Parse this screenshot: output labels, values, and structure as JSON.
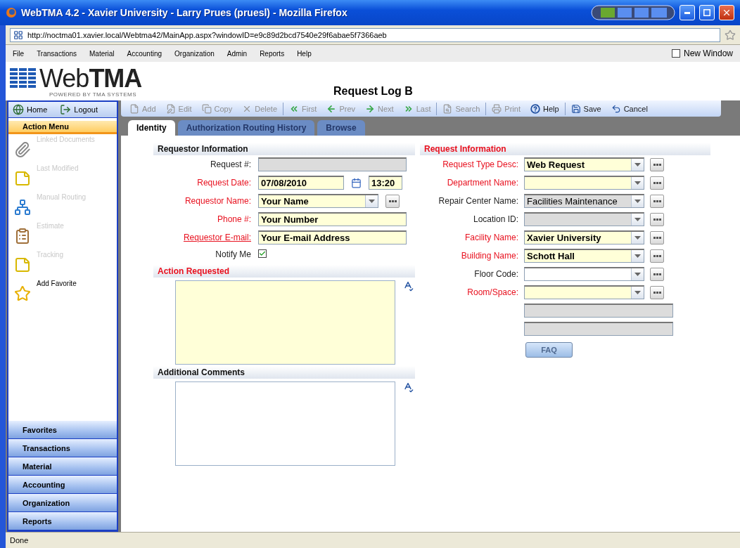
{
  "window": {
    "title": "WebTMA 4.2 - Xavier University - Larry Prues (pruesl) - Mozilla Firefox"
  },
  "address_bar": {
    "url": "http://noctma01.xavier.local/Webtma42/MainApp.aspx?windowID=e9c89d2bcd7540e29f6abae5f7366aeb"
  },
  "menu": [
    "File",
    "Transactions",
    "Material",
    "Accounting",
    "Organization",
    "Admin",
    "Reports",
    "Help"
  ],
  "new_window": {
    "label": "New Window",
    "checked": false
  },
  "logo": {
    "text": "Web**TMA**",
    "tagline": "POWERED BY TMA SYSTEMS"
  },
  "page_title": "Request Log B",
  "nav": [
    {
      "label": "Home",
      "kind": "home"
    },
    {
      "label": "Logout",
      "kind": "logout"
    }
  ],
  "action_menu": {
    "title": "Action Menu",
    "items": [
      {
        "label": "Linked Documents",
        "kind": "clip",
        "disabled": true
      },
      {
        "label": "Last Modified",
        "kind": "clock",
        "disabled": true
      },
      {
        "label": "Manual Routing",
        "kind": "routing",
        "disabled": true
      },
      {
        "label": "Estimate",
        "kind": "clipboard",
        "disabled": true
      },
      {
        "label": "Tracking",
        "kind": "track",
        "disabled": true
      },
      {
        "label": "Add Favorite",
        "kind": "star",
        "disabled": false
      }
    ]
  },
  "sections": [
    "Favorites",
    "Transactions",
    "Material",
    "Accounting",
    "Organization",
    "Reports"
  ],
  "toolbar": [
    [
      {
        "label": "Add",
        "kind": "add",
        "disabled": true
      },
      {
        "label": "Edit",
        "kind": "edit",
        "disabled": true
      },
      {
        "label": "Copy",
        "kind": "copy",
        "disabled": true
      },
      {
        "label": "Delete",
        "kind": "delete",
        "disabled": true
      }
    ],
    [
      {
        "label": "First",
        "kind": "first",
        "disabled": true
      },
      {
        "label": "Prev",
        "kind": "prev",
        "disabled": true
      },
      {
        "label": "Next",
        "kind": "next",
        "disabled": true
      },
      {
        "label": "Last",
        "kind": "last",
        "disabled": true
      }
    ],
    [
      {
        "label": "Search",
        "kind": "search",
        "disabled": true
      }
    ],
    [
      {
        "label": "Print",
        "kind": "print",
        "disabled": true
      },
      {
        "label": "Help",
        "kind": "help",
        "disabled": false
      }
    ],
    [
      {
        "label": "Save",
        "kind": "save",
        "disabled": false
      },
      {
        "label": "Cancel",
        "kind": "cancel",
        "disabled": false
      }
    ]
  ],
  "tabs": [
    {
      "label": "Identity",
      "selected": true
    },
    {
      "label": "Authorization Routing History",
      "selected": false
    },
    {
      "label": "Browse",
      "selected": false
    }
  ],
  "requestor": {
    "title": "Requestor Information",
    "fields": [
      {
        "label": "Request #:",
        "kind": "text",
        "required": false,
        "disabled": true
      },
      {
        "label": "Request Date:",
        "kind": "date",
        "required": true,
        "disabled": false,
        "value": "07/08/2010",
        "time": "13:20"
      },
      {
        "label": "Requestor Name:",
        "kind": "combo",
        "required": true,
        "disabled": false,
        "value": "Your Name"
      },
      {
        "label": "Phone #:",
        "kind": "text",
        "required": true,
        "disabled": false,
        "value": "Your Number"
      },
      {
        "label": "Requestor E-mail:",
        "kind": "link",
        "required": true,
        "disabled": false,
        "value": "Your E-mail Address"
      },
      {
        "label": "Notify Me",
        "kind": "checkbox",
        "checked": true
      }
    ]
  },
  "action_requested": {
    "title": "Action Requested",
    "required": true
  },
  "additional_comments": {
    "title": "Additional Comments",
    "required": false
  },
  "request": {
    "title": "Request Information",
    "fields": [
      {
        "label": "Request Type Desc:",
        "required": true,
        "disabled": false,
        "value": "Web Request"
      },
      {
        "label": "Department Name:",
        "required": true,
        "disabled": false
      },
      {
        "label": "Repair Center Name:",
        "required": false,
        "disabled": true,
        "value": "Facilities Maintenance"
      },
      {
        "label": "Location ID:",
        "required": false,
        "disabled": true
      },
      {
        "label": "Facility Name:",
        "required": true,
        "disabled": false,
        "value": "Xavier University"
      },
      {
        "label": "Building Name:",
        "required": true,
        "disabled": false,
        "value": "Schott Hall"
      },
      {
        "label": "Floor Code:",
        "required": false,
        "disabled": false
      },
      {
        "label": "Room/Space:",
        "required": true,
        "disabled": false
      }
    ],
    "extra_fields": [
      {
        "disabled": true
      },
      {
        "disabled": true
      }
    ],
    "faq": "FAQ"
  },
  "status_bar": "Done"
}
